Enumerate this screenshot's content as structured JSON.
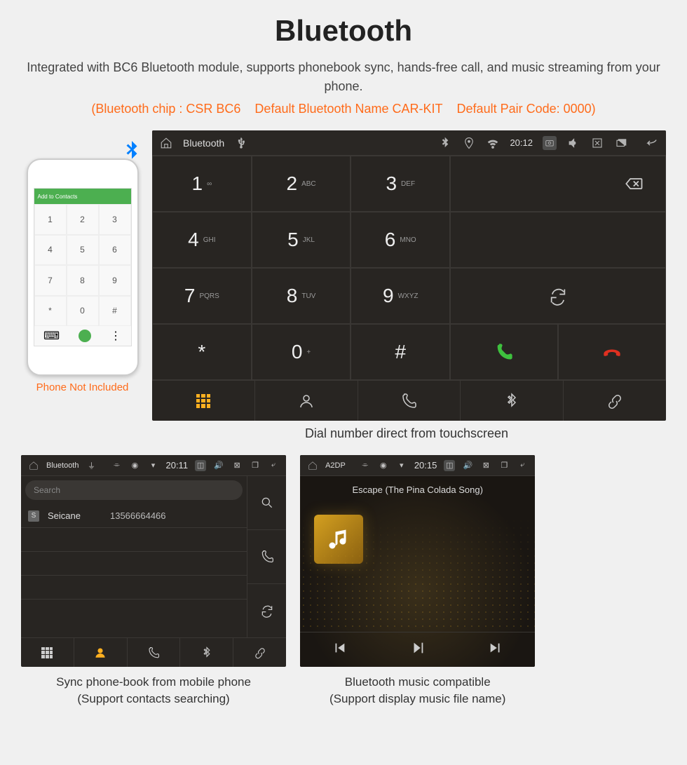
{
  "header": {
    "title": "Bluetooth",
    "subtitle": "Integrated with BC6 Bluetooth module, supports phonebook sync, hands-free call, and music streaming from your phone.",
    "specs": "(Bluetooth chip : CSR BC6    Default Bluetooth Name CAR-KIT    Default Pair Code: 0000)"
  },
  "phone": {
    "caption": "Phone Not Included",
    "topbar": "Add to Contacts"
  },
  "main_unit": {
    "bar": {
      "title": "Bluetooth",
      "time": "20:12"
    },
    "keys": [
      {
        "num": "1",
        "sub": "∞"
      },
      {
        "num": "2",
        "sub": "ABC"
      },
      {
        "num": "3",
        "sub": "DEF"
      },
      {
        "num": "4",
        "sub": "GHI"
      },
      {
        "num": "5",
        "sub": "JKL"
      },
      {
        "num": "6",
        "sub": "MNO"
      },
      {
        "num": "7",
        "sub": "PQRS"
      },
      {
        "num": "8",
        "sub": "TUV"
      },
      {
        "num": "9",
        "sub": "WXYZ"
      },
      {
        "num": "*",
        "sub": ""
      },
      {
        "num": "0",
        "sub": "+"
      },
      {
        "num": "#",
        "sub": ""
      }
    ],
    "caption": "Dial number direct from touchscreen"
  },
  "phonebook": {
    "bar": {
      "title": "Bluetooth",
      "time": "20:11"
    },
    "search_placeholder": "Search",
    "contact": {
      "badge": "S",
      "name": "Seicane",
      "number": "13566664466"
    },
    "caption_l1": "Sync phone-book from mobile phone",
    "caption_l2": "(Support contacts searching)"
  },
  "music": {
    "bar": {
      "title": "A2DP",
      "time": "20:15"
    },
    "track": "Escape (The Pina Colada Song)",
    "caption_l1": "Bluetooth music compatible",
    "caption_l2": "(Support display music file name)"
  }
}
